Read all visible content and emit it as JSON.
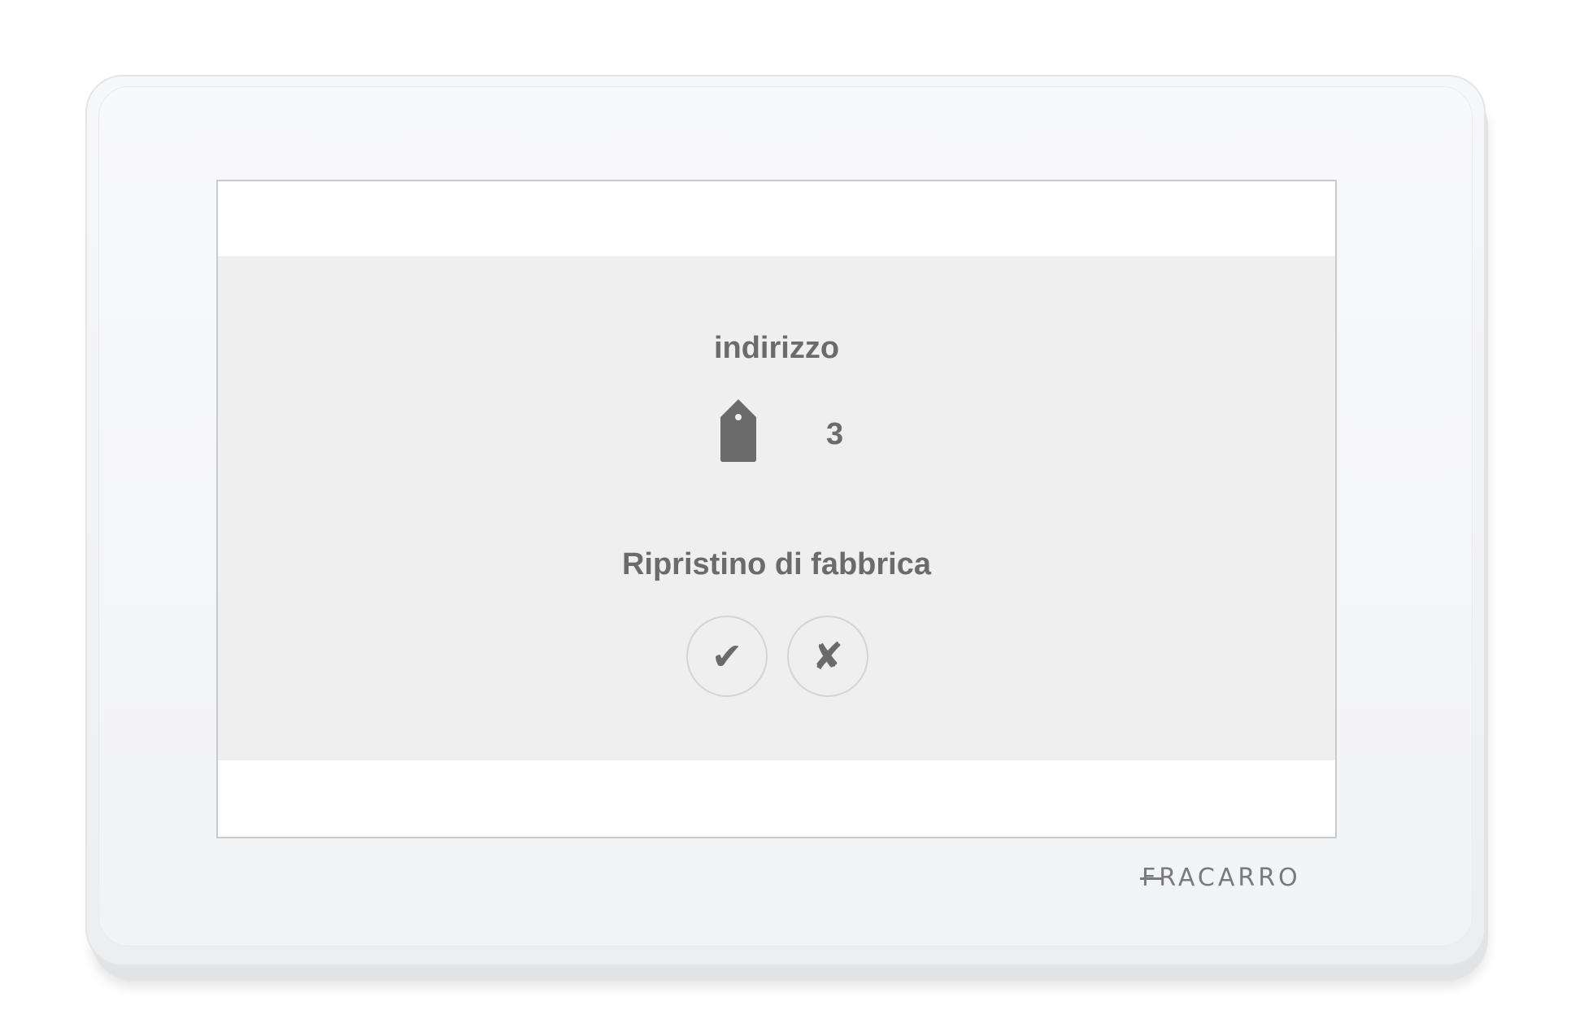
{
  "screen": {
    "title": "indirizzo",
    "address_value": "3",
    "subtitle": "Ripristino di fabbrica",
    "confirm_symbol": "✔",
    "cancel_symbol": "✘",
    "tag_icon": "tag-icon"
  },
  "device": {
    "brand": "FRACARRO"
  },
  "colors": {
    "text": "#6b6b6b",
    "band": "#efefef",
    "bezel": "#f4f5f6"
  }
}
